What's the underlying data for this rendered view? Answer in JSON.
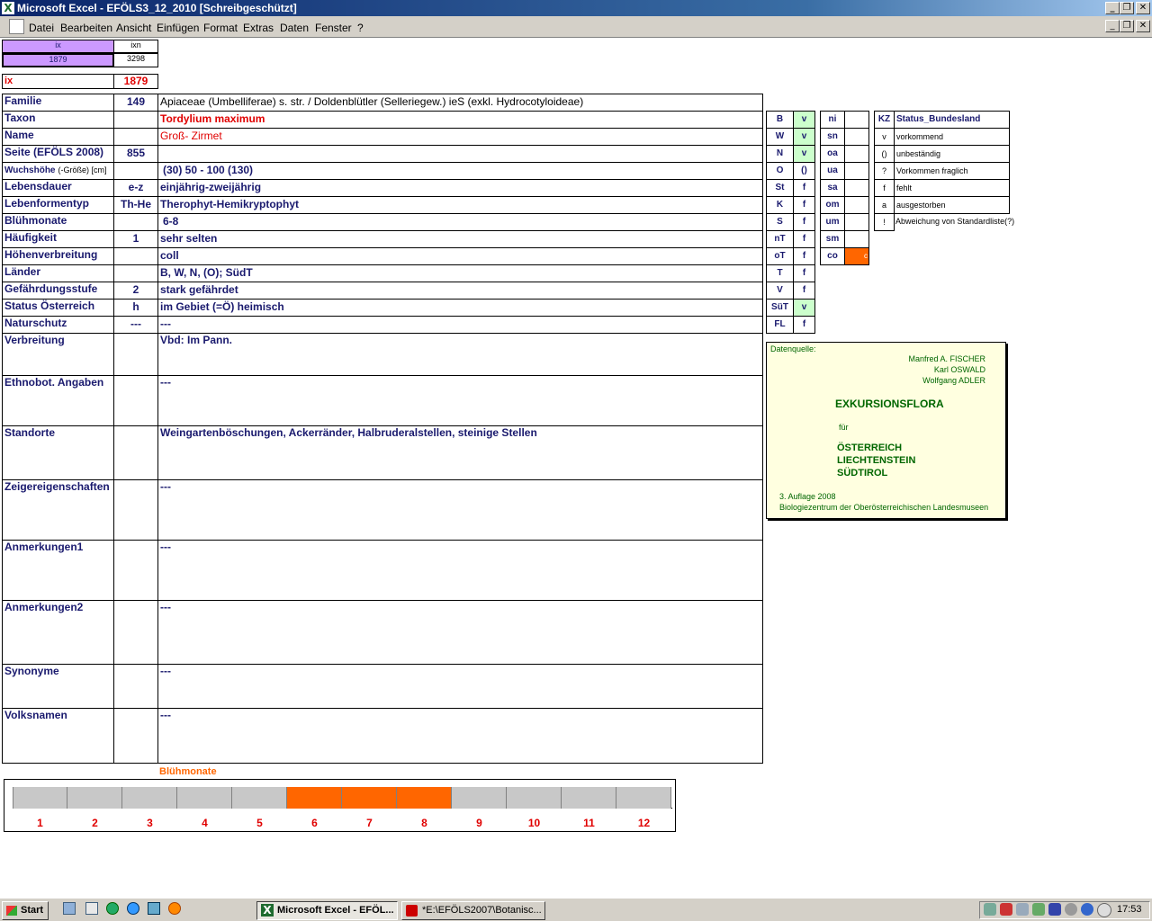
{
  "window": {
    "title": "Microsoft Excel - EFÖLS3_12_2010  [Schreibgeschützt]",
    "app_icon": "excel-icon"
  },
  "menu": [
    "Datei",
    "Bearbeiten",
    "Ansicht",
    "Einfügen",
    "Format",
    "Extras",
    "Daten",
    "Fenster",
    "?"
  ],
  "index": {
    "ix_label": "ix",
    "ixn_label": "ixn",
    "ix_value": "1879",
    "ixn_value": "3298",
    "ix_row_label": "ix",
    "ix_row_value": "1879"
  },
  "record": [
    {
      "label": "Familie",
      "code": "149",
      "value": "Apiaceae (Umbelliferae) s. str.  /  Doldenblütler (Selleriegew.) ieS (exkl. Hydrocotyloideae)"
    },
    {
      "label": "Taxon",
      "code": "",
      "value": "Tordylium maximum"
    },
    {
      "label": "Name",
      "code": "",
      "value": "Groß- Zirmet"
    },
    {
      "label": "Seite (EFÖLS 2008)",
      "code": "855",
      "value": ""
    },
    {
      "label": "Wuchshöhe",
      "label_suffix": "(-Größe) [cm]",
      "code": "",
      "value": "(30) 50 - 100 (130)"
    },
    {
      "label": "Lebensdauer",
      "code": "e-z",
      "value": "einjährig-zweijährig"
    },
    {
      "label": "Lebenformentyp",
      "code": "Th-He",
      "value": "Therophyt-Hemikryptophyt"
    },
    {
      "label": "Blühmonate",
      "code": "",
      "value": "6-8"
    },
    {
      "label": "Häufigkeit",
      "code": "1",
      "value": "sehr selten"
    },
    {
      "label": "Höhenverbreitung",
      "code": "",
      "value": "coll"
    },
    {
      "label": "Länder",
      "code": "",
      "value": "B, W, N, (O); SüdT"
    },
    {
      "label": "Gefährdungsstufe",
      "code": "2",
      "value": "stark gefährdet"
    },
    {
      "label": "Status Österreich",
      "code": "h",
      "value": "im Gebiet (=Ö) heimisch"
    },
    {
      "label": "Naturschutz",
      "code": "---",
      "value": "---"
    },
    {
      "label": "Verbreitung",
      "code": "",
      "value": "Vbd: Im Pann."
    },
    {
      "label": "Ethnobot. Angaben",
      "code": "",
      "value": "---"
    },
    {
      "label": "Standorte",
      "code": "",
      "value": "Weingartenböschungen, Ackerränder, Halbruderalstellen, steinige Stellen"
    },
    {
      "label": "Zeigereigenschaften",
      "code": "",
      "value": "---"
    },
    {
      "label": "Anmerkungen1",
      "code": "",
      "value": "---"
    },
    {
      "label": "Anmerkungen2",
      "code": "",
      "value": "---"
    },
    {
      "label": "Synonyme",
      "code": "",
      "value": "---"
    },
    {
      "label": "Volksnamen",
      "code": "",
      "value": "---"
    }
  ],
  "bundesland": [
    {
      "code": "B",
      "status": "v"
    },
    {
      "code": "W",
      "status": "v"
    },
    {
      "code": "N",
      "status": "v"
    },
    {
      "code": "O",
      "status": "()"
    },
    {
      "code": "St",
      "status": "f"
    },
    {
      "code": "K",
      "status": "f"
    },
    {
      "code": "S",
      "status": "f"
    },
    {
      "code": "nT",
      "status": "f"
    },
    {
      "code": "oT",
      "status": "f"
    },
    {
      "code": "T",
      "status": "f"
    },
    {
      "code": "V",
      "status": "f"
    },
    {
      "code": "SüT",
      "status": "v"
    },
    {
      "code": "FL",
      "status": "f"
    }
  ],
  "hoehenstufen": [
    {
      "code": "ni",
      "value": ""
    },
    {
      "code": "sn",
      "value": ""
    },
    {
      "code": "oa",
      "value": ""
    },
    {
      "code": "ua",
      "value": ""
    },
    {
      "code": "sa",
      "value": ""
    },
    {
      "code": "om",
      "value": ""
    },
    {
      "code": "um",
      "value": ""
    },
    {
      "code": "sm",
      "value": ""
    },
    {
      "code": "co",
      "value": "c"
    }
  ],
  "legend": {
    "kz_header": "KZ",
    "status_header": "Status_Bundesland",
    "items": [
      {
        "kz": "v",
        "text": "vorkommend"
      },
      {
        "kz": "()",
        "text": "unbeständig"
      },
      {
        "kz": "?",
        "text": "Vorkommen fraglich"
      },
      {
        "kz": "f",
        "text": "fehlt"
      },
      {
        "kz": "a",
        "text": "ausgestorben"
      },
      {
        "kz": "!",
        "text": "Abweichung von Standardliste(?)"
      }
    ]
  },
  "source": {
    "label": "Datenquelle:",
    "authors": [
      "Manfred A. FISCHER",
      "Karl OSWALD",
      "Wolfgang ADLER"
    ],
    "book_title": "EXKURSIONSFLORA",
    "fuer": "für",
    "countries": [
      "ÖSTERREICH",
      "LIECHTENSTEIN",
      "SÜDTIROL"
    ],
    "edition": "3. Auflage 2008",
    "publisher": "Biologiezentrum der Oberösterreichischen Landesmuseen"
  },
  "chart_data": {
    "type": "bar",
    "title": "Blühmonate",
    "categories": [
      "1",
      "2",
      "3",
      "4",
      "5",
      "6",
      "7",
      "8",
      "9",
      "10",
      "11",
      "12"
    ],
    "flowering": [
      false,
      false,
      false,
      false,
      false,
      true,
      true,
      true,
      false,
      false,
      false,
      false
    ],
    "colors": {
      "flowering": "#ff6600",
      "not_flowering": "#c8c8c8"
    }
  },
  "taskbar": {
    "start": "Start",
    "tasks": [
      "Microsoft Excel - EFÖL...",
      "*E:\\EFÖLS2007\\Botanisc..."
    ],
    "clock": "17:53"
  }
}
